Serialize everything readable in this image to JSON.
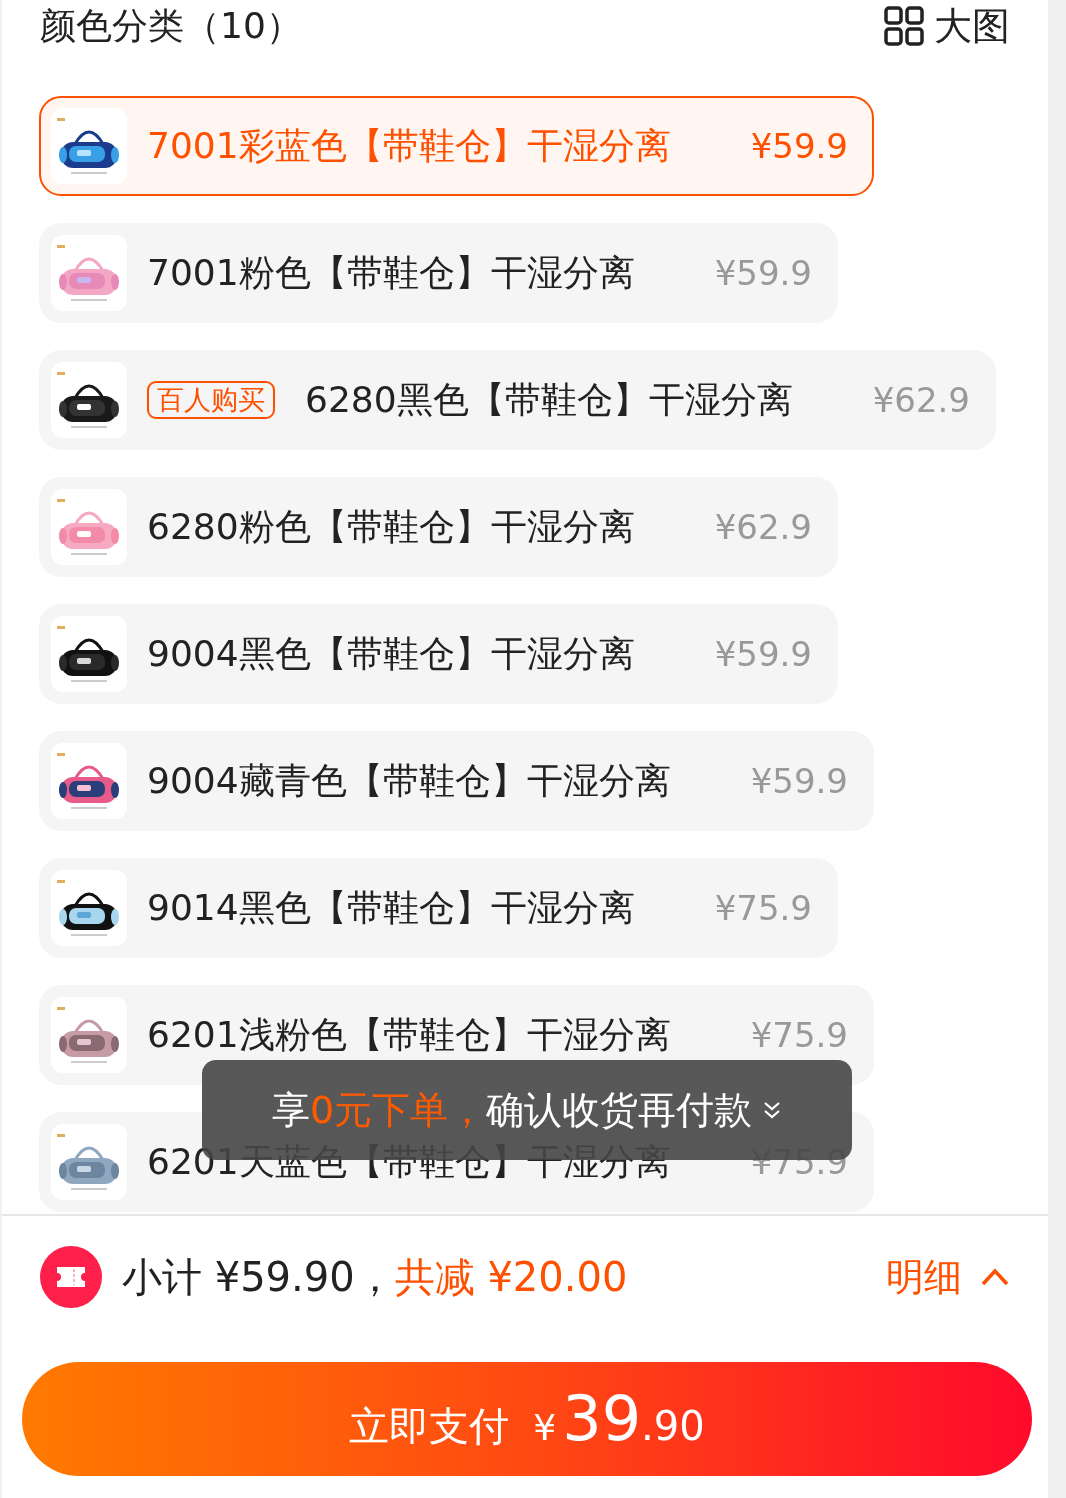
{
  "header": {
    "title": "颜色分类（10）",
    "view_toggle": "大图"
  },
  "options": [
    {
      "name": "7001彩蓝色【带鞋仓】干湿分离",
      "price": "¥59.9",
      "selected": true
    },
    {
      "name": "7001粉色【带鞋仓】干湿分离",
      "price": "¥59.9",
      "selected": false
    },
    {
      "name": "6280黑色【带鞋仓】干湿分离",
      "price": "¥62.9",
      "selected": false,
      "badge": "百人购买"
    },
    {
      "name": "6280粉色【带鞋仓】干湿分离",
      "price": "¥62.9",
      "selected": false
    },
    {
      "name": "9004黑色【带鞋仓】干湿分离",
      "price": "¥59.9",
      "selected": false
    },
    {
      "name": "9004藏青色【带鞋仓】干湿分离",
      "price": "¥59.9",
      "selected": false
    },
    {
      "name": "9014黑色【带鞋仓】干湿分离",
      "price": "¥75.9",
      "selected": false
    },
    {
      "name": "6201浅粉色【带鞋仓】干湿分离",
      "price": "¥75.9",
      "selected": false
    },
    {
      "name": "6201天蓝色【带鞋仓】干湿分离",
      "price": "¥75.9",
      "selected": false
    }
  ],
  "toast": {
    "parts": [
      {
        "text": "享",
        "highlight": false
      },
      {
        "text": "0元下单，",
        "highlight": true
      },
      {
        "text": "确认收货再付款",
        "highlight": false
      }
    ]
  },
  "summary": {
    "subtotal": "小计 ¥59.90，",
    "discount": "共减 ¥20.00",
    "details": "明细"
  },
  "pay_button": {
    "label": "立即支付",
    "currency": "¥",
    "amount_int": "39",
    "amount_dec": ".90"
  }
}
